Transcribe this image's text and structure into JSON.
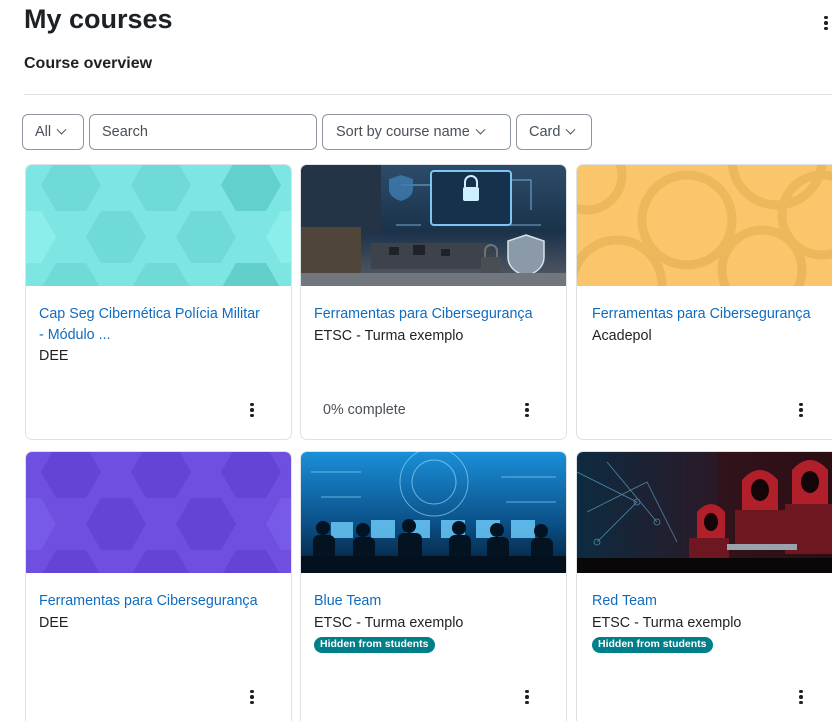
{
  "page": {
    "title": "My courses",
    "section_title": "Course overview"
  },
  "filters": {
    "grouping_label": "All",
    "search_placeholder": "Search",
    "sort_label": "Sort by course name",
    "view_label": "Card"
  },
  "courses": [
    {
      "name_line1": "Cap Seg Cibernética Polícia Militar",
      "name_line2": "- Módulo ...",
      "category": "DEE",
      "progress": "",
      "hidden_badge": "",
      "image": "hexagon-pattern",
      "image_color": "#7ee6e2"
    },
    {
      "name_line1": "Ferramentas para Cibersegurança",
      "name_line2": "",
      "category": "ETSC - Turma exemplo",
      "progress": "0% complete",
      "hidden_badge": "",
      "image": "cybersecurity-desk-photo",
      "image_color": "#1d3a55"
    },
    {
      "name_line1": "Ferramentas para Cibersegurança",
      "name_line2": "",
      "category": "Acadepol",
      "progress": "",
      "hidden_badge": "",
      "image": "circles-pattern",
      "image_color": "#fbc56b"
    },
    {
      "name_line1": "Ferramentas para Cibersegurança",
      "name_line2": "",
      "category": "DEE",
      "progress": "",
      "hidden_badge": "",
      "image": "hexagon-pattern",
      "image_color": "#6f4fe0"
    },
    {
      "name_line1": "Blue Team",
      "name_line2": "",
      "category": "ETSC - Turma exemplo",
      "progress": "",
      "hidden_badge": "Hidden from students",
      "image": "blue-team-photo",
      "image_color": "#0b4f86"
    },
    {
      "name_line1": "Red Team",
      "name_line2": "",
      "category": "ETSC - Turma exemplo",
      "progress": "",
      "hidden_badge": "Hidden from students",
      "image": "red-team-photo",
      "image_color": "#3a1218"
    }
  ],
  "icons": {
    "page_menu": "kebab-menu-icon",
    "card_menu": "kebab-menu-icon",
    "dropdown": "chevron-down-icon"
  },
  "colors": {
    "link": "#0f6cbf",
    "badge": "#007f8a",
    "border": "#dee2e6",
    "control_border": "#8f959e"
  }
}
